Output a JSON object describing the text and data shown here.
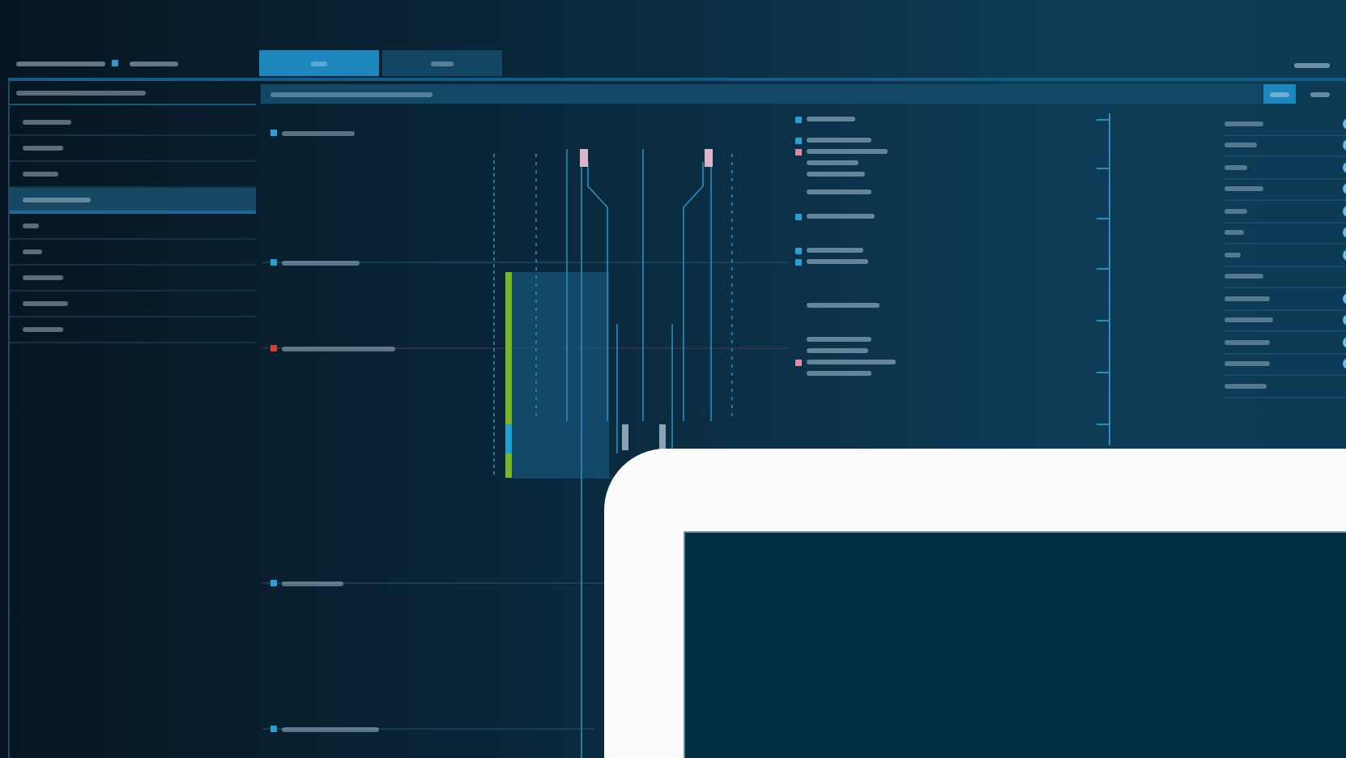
{
  "header": {
    "status": {
      "color": "#2a9fd6"
    }
  },
  "tabs": [
    {
      "selected": true
    },
    {
      "selected": false
    }
  ],
  "sidebar": {
    "items": [
      {
        "selected": false
      },
      {
        "selected": false
      },
      {
        "selected": false
      },
      {
        "selected": true
      },
      {
        "selected": false
      },
      {
        "selected": false
      },
      {
        "selected": false
      },
      {
        "selected": false
      },
      {
        "selected": false
      }
    ]
  },
  "toolbar_buttons": [
    {
      "selected": true
    },
    {
      "selected": false
    }
  ],
  "events": [
    {
      "color": "#2a9fd6"
    },
    {
      "color": "#2a9fd6"
    },
    {
      "color": "#d9412b"
    },
    {
      "color": "#2a9fd6"
    },
    {
      "color": "#2a9fd6"
    }
  ],
  "event_list": [
    {
      "kind": "marked",
      "color": "#2a9fd6"
    },
    {
      "kind": "marked",
      "color": "#2a9fd6"
    },
    {
      "kind": "marked",
      "color": "#e08aa8"
    },
    {
      "kind": "plain"
    },
    {
      "kind": "plain"
    },
    {
      "kind": "plain"
    },
    {
      "kind": "marked",
      "color": "#2a9fd6"
    },
    {
      "kind": "marked",
      "color": "#2a9fd6"
    },
    {
      "kind": "marked",
      "color": "#2a9fd6"
    },
    {
      "kind": "plain"
    },
    {
      "kind": "plain"
    },
    {
      "kind": "plain"
    },
    {
      "kind": "marked",
      "color": "#e08aa8"
    },
    {
      "kind": "plain"
    }
  ],
  "toggles": [
    {
      "on": true
    },
    {
      "on": true
    },
    {
      "on": true
    },
    {
      "on": true
    },
    {
      "on": true
    },
    {
      "on": true
    },
    {
      "on": true
    },
    {
      "on": false
    },
    {
      "on": true
    },
    {
      "on": true
    },
    {
      "on": true
    },
    {
      "on": true
    },
    {
      "on": false
    }
  ]
}
